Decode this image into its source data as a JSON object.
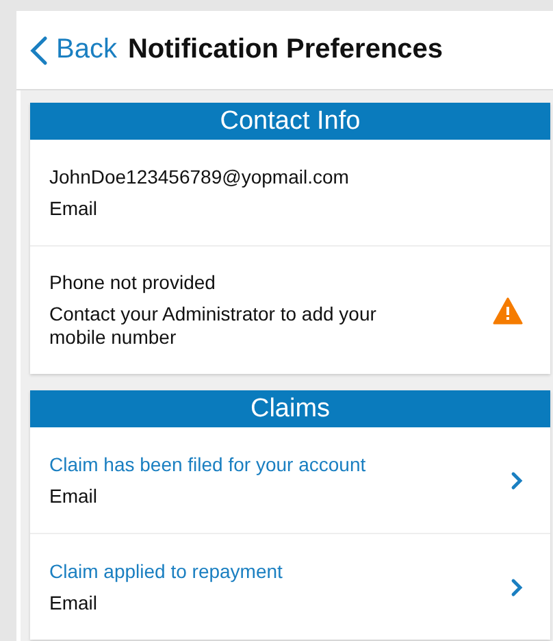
{
  "header": {
    "back": "Back",
    "title": "Notification Preferences"
  },
  "sections": [
    {
      "title": "Contact Info",
      "rows": [
        {
          "kind": "info",
          "primary": "JohnDoe123456789@yopmail.com",
          "secondary": "Email",
          "warning": false
        },
        {
          "kind": "info",
          "primary": "Phone not provided",
          "secondary": "Contact your Administrator to add your mobile number",
          "warning": true
        }
      ]
    },
    {
      "title": "Claims",
      "rows": [
        {
          "kind": "link",
          "primary": "Claim has been filed for your account",
          "secondary": "Email"
        },
        {
          "kind": "link",
          "primary": "Claim applied to repayment",
          "secondary": "Email"
        }
      ]
    }
  ]
}
